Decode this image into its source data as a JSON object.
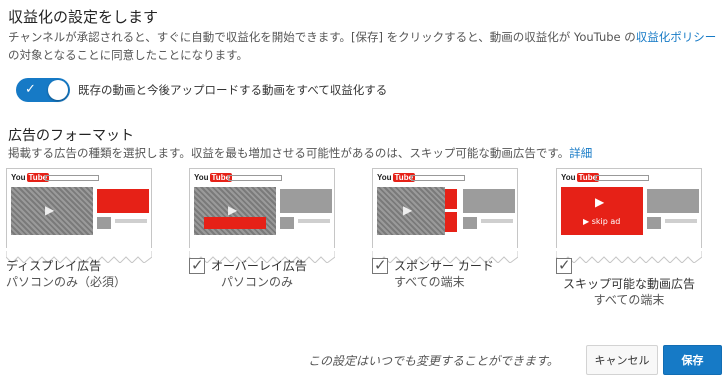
{
  "heading": "収益化の設定をします",
  "description": {
    "text1": "チャンネルが承認されると、すぐに自動で収益化を開始できます。[保存] をクリックすると、動画の収益化が YouTube の",
    "link1": "収益化ポリシー",
    "text2": "の対象となることに同意したことになります。"
  },
  "toggle": {
    "checked": true,
    "check_glyph": "✓",
    "label": "既存の動画と今後アップロードする動画をすべて収益化する"
  },
  "formats": {
    "title": "広告のフォーマット",
    "description": "掲載する広告の種類を選択します。収益を最も増加させる可能性があるのは、スキップ可能な動画広告です。",
    "link": "詳細",
    "logo": {
      "you": "You",
      "tube": "Tube"
    },
    "skip_ad_text": "▶ skip ad",
    "play_glyph": "▶︎",
    "items": [
      {
        "title": "ディスプレイ広告",
        "subtitle": "パソコンのみ（必須）",
        "has_checkbox": false
      },
      {
        "title": "オーバーレイ広告",
        "subtitle": "パソコンのみ",
        "has_checkbox": true,
        "checked": true
      },
      {
        "title": "スポンサー カード",
        "subtitle": "すべての端末",
        "has_checkbox": true,
        "checked": true
      },
      {
        "title": "スキップ可能な動画広告",
        "subtitle": "すべての端末",
        "has_checkbox": true,
        "checked": true
      }
    ]
  },
  "footer": {
    "note": "この設定はいつでも変更することができます。",
    "cancel": "キャンセル",
    "save": "保存"
  },
  "colors": {
    "accent": "#167ac6",
    "ad_red": "#e62117"
  }
}
